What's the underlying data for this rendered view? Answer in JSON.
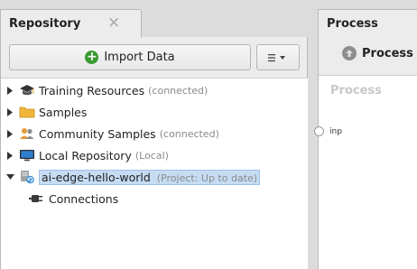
{
  "repository": {
    "tab_title": "Repository",
    "close_symbol": "×",
    "import_button_label": "Import Data",
    "menu_button_icon": "hamburger-dropdown-icon",
    "items": [
      {
        "label": "Training Resources",
        "meta": "(connected)",
        "icon": "graduation-cap-icon",
        "expanded": false
      },
      {
        "label": "Samples",
        "meta": "",
        "icon": "folder-icon",
        "expanded": false
      },
      {
        "label": "Community Samples",
        "meta": "(connected)",
        "icon": "community-icon",
        "expanded": false
      },
      {
        "label": "Local Repository",
        "meta": "(Local)",
        "icon": "monitor-icon",
        "expanded": false
      },
      {
        "label": "ai-edge-hello-world",
        "meta": "(Project: Up to date)",
        "icon": "project-icon",
        "expanded": true,
        "selected": true
      },
      {
        "label": "Connections",
        "meta": "",
        "icon": "plug-icon",
        "child": true
      }
    ]
  },
  "process": {
    "tab_title": "Process",
    "button_label": "Process",
    "canvas_label": "Process",
    "port_label": "inp"
  },
  "colors": {
    "selection_bg": "#c6dcf3",
    "import_icon": "#3a9b30",
    "muted_text": "#8a8a8a"
  }
}
